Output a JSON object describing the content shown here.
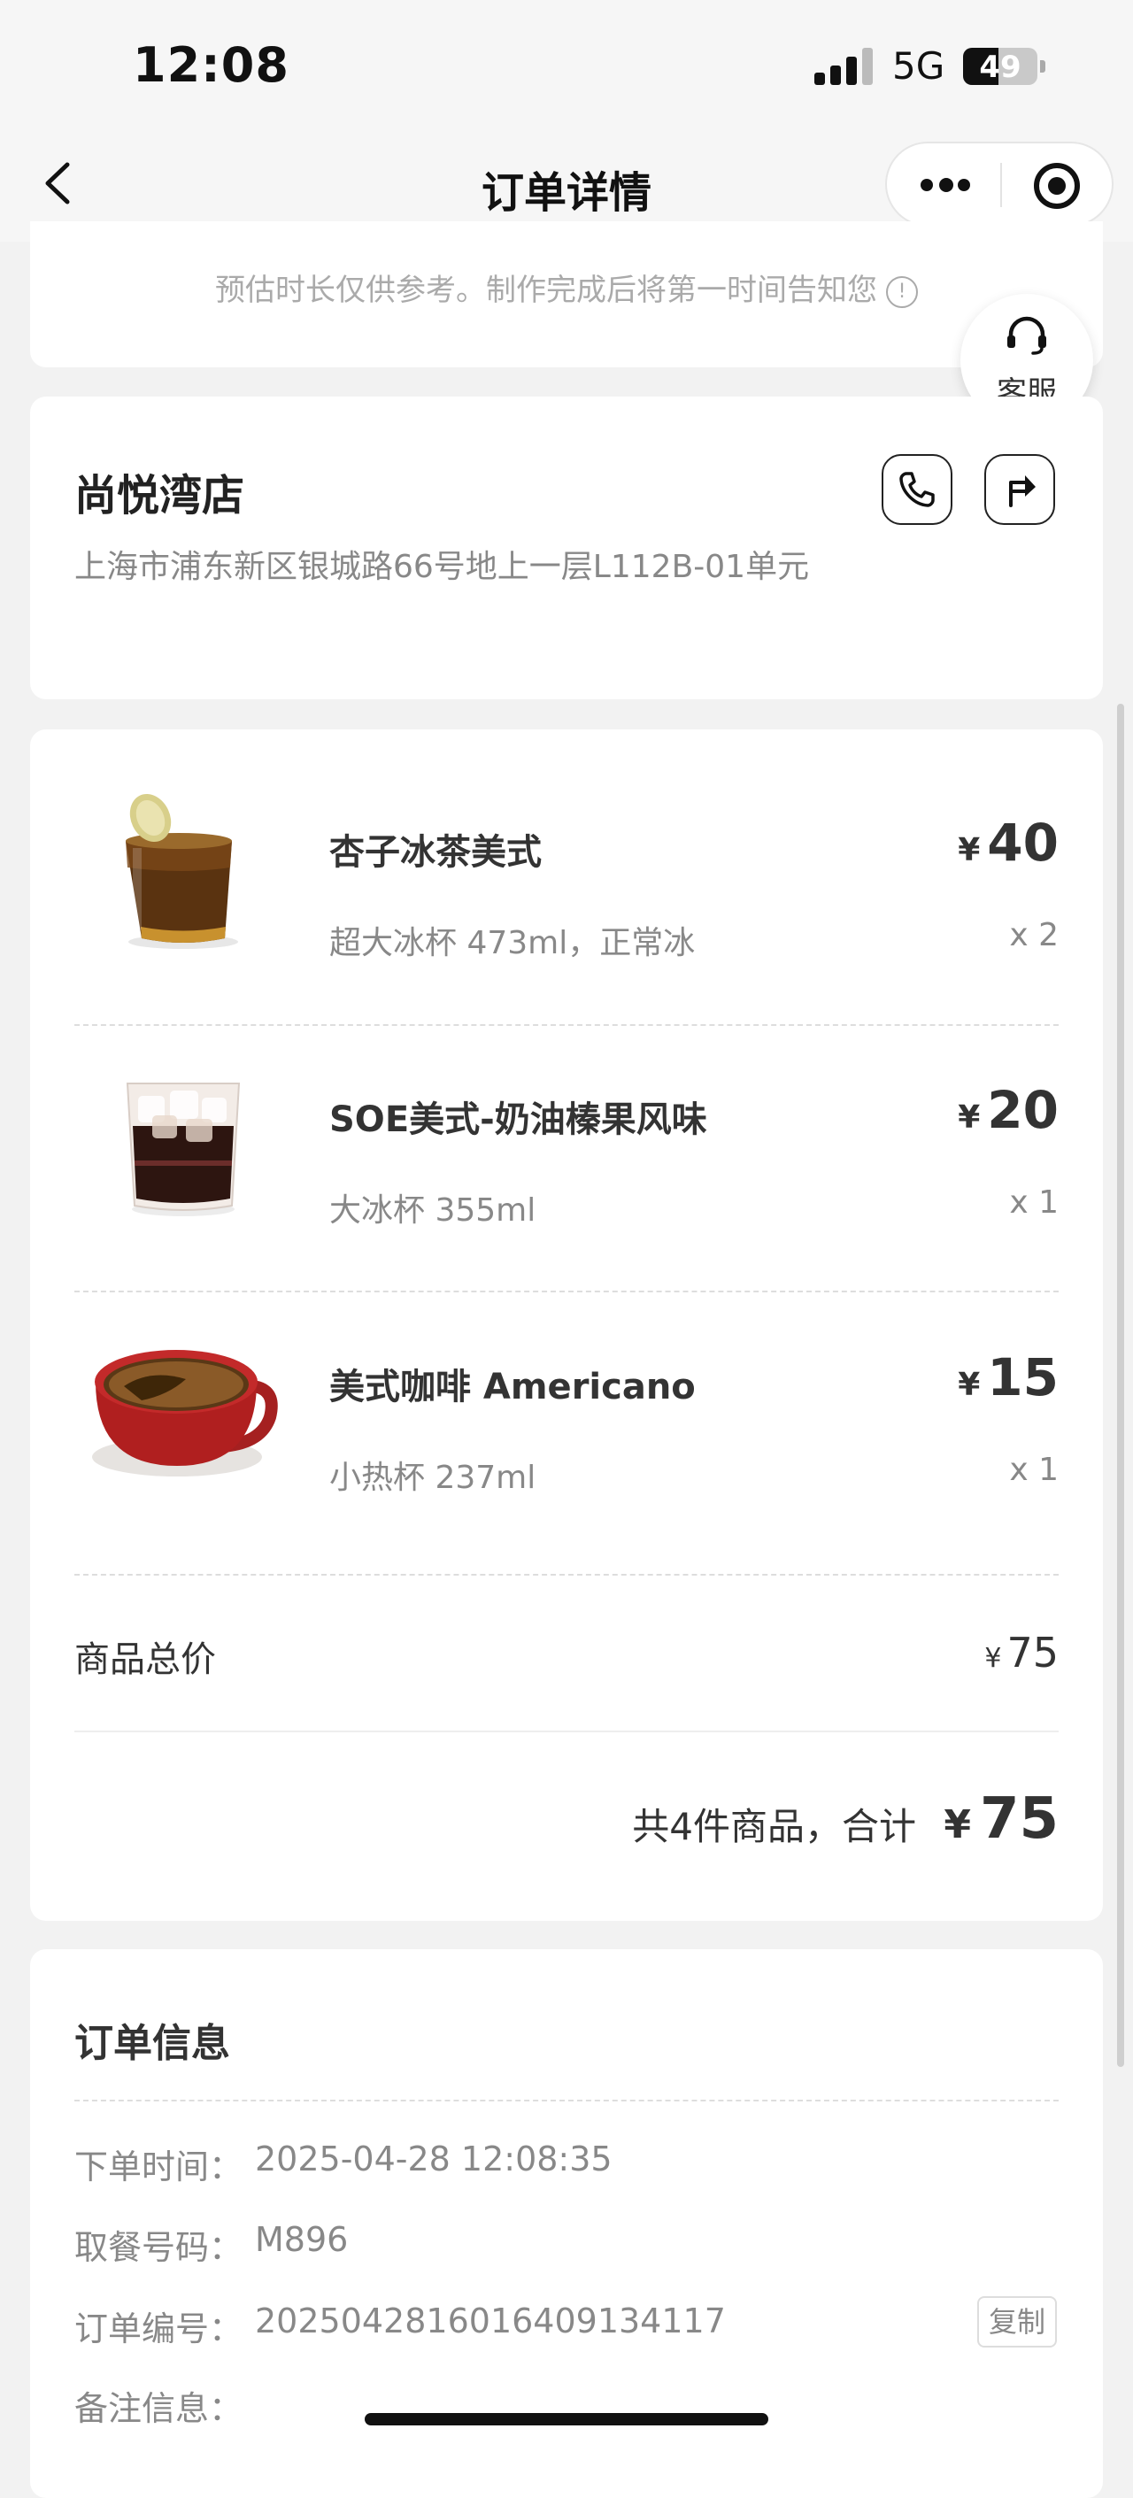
{
  "status_bar": {
    "time": "12:08",
    "network": "5G",
    "battery": "49"
  },
  "nav": {
    "title": "订单详情"
  },
  "notice": {
    "text": "预估时长仅供参考。制作完成后将第一时间告知您",
    "icon": "info-icon"
  },
  "service": {
    "label": "客服",
    "icon": "headset-icon"
  },
  "store": {
    "name": "尚悦湾店",
    "address": "上海市浦东新区银城路66号地上一层L112B-01单元",
    "phone_icon": "phone-icon",
    "nav_icon": "navigate-icon"
  },
  "items": [
    {
      "name": "杏子冰茶美式",
      "spec": "超大冰杯 473ml，正常冰",
      "currency": "¥",
      "price": "40",
      "qty": "x 2"
    },
    {
      "name": "SOE美式-奶油榛果风味",
      "spec": "大冰杯 355ml",
      "currency": "¥",
      "price": "20",
      "qty": "x 1"
    },
    {
      "name": "美式咖啡 Americano",
      "spec": "小热杯 237ml",
      "currency": "¥",
      "price": "15",
      "qty": "x 1"
    }
  ],
  "summary": {
    "subtotal_label": "商品总价",
    "subtotal_currency": "¥",
    "subtotal": "75",
    "total_label": "共4件商品，合计",
    "total_currency": "¥",
    "total": "75"
  },
  "order_info": {
    "title": "订单信息",
    "rows": [
      {
        "key": "下单时间：",
        "value": "2025-04-28 12:08:35"
      },
      {
        "key": "取餐号码：",
        "value": "M896"
      },
      {
        "key": "订单编号：",
        "value": "2025042816016409134117"
      },
      {
        "key": "备注信息：",
        "value": ""
      }
    ],
    "copy_label": "复制"
  }
}
